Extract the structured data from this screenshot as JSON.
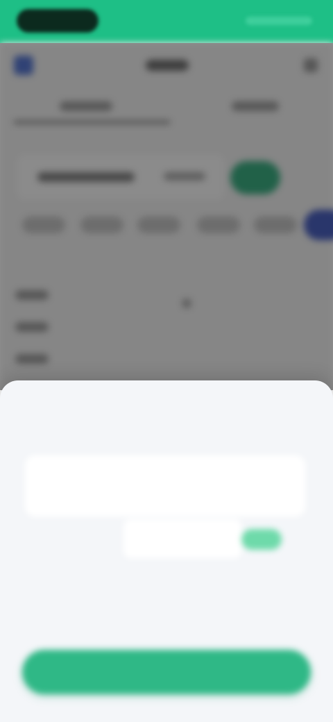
{
  "status_bar": {
    "color": "#1ebf86"
  },
  "background_app": {
    "back_icon": "back-arrow-icon",
    "accent_color": "#1a9f6c",
    "active_chip_color": "#2b45b4"
  },
  "sheet": {
    "title": "",
    "close_label": "",
    "amount": {
      "label": "",
      "hint": "",
      "value": ""
    },
    "field": {
      "label": "",
      "placeholder": "",
      "badge": ""
    },
    "warning": "",
    "sub_link": "",
    "confirm_label": "",
    "accent_color": "#2fb886",
    "warning_color": "#d54a4a"
  }
}
